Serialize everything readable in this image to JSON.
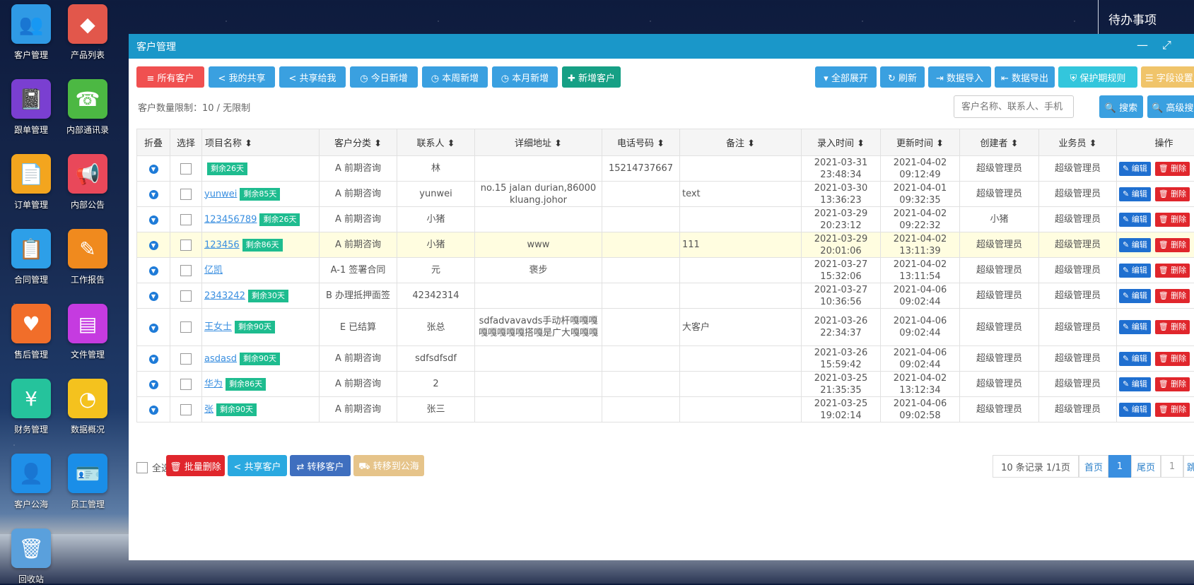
{
  "desktop": {
    "icons": [
      {
        "label": "客户管理",
        "color": "#2f9ae5",
        "glyph": "👥",
        "icon": "users-icon"
      },
      {
        "label": "产品列表",
        "color": "#e2574b",
        "glyph": "◆",
        "icon": "grid-icon"
      },
      {
        "label": "跟单管理",
        "color": "#7a3fd1",
        "glyph": "📓",
        "icon": "notebook-icon"
      },
      {
        "label": "内部通讯录",
        "color": "#4cb843",
        "glyph": "☎",
        "icon": "phone-book-icon"
      },
      {
        "label": "订单管理",
        "color": "#f3a51e",
        "glyph": "📄",
        "icon": "document-icon"
      },
      {
        "label": "内部公告",
        "color": "#e9485a",
        "glyph": "📢",
        "icon": "megaphone-icon"
      },
      {
        "label": "合同管理",
        "color": "#2d9fe8",
        "glyph": "📋",
        "icon": "contract-icon"
      },
      {
        "label": "工作报告",
        "color": "#f08a1e",
        "glyph": "✎",
        "icon": "report-icon"
      },
      {
        "label": "售后管理",
        "color": "#f16e2a",
        "glyph": "♥",
        "icon": "handshake-icon"
      },
      {
        "label": "文件管理",
        "color": "#c53be0",
        "glyph": "▤",
        "icon": "file-icon"
      },
      {
        "label": "财务管理",
        "color": "#25c39c",
        "glyph": "¥",
        "icon": "finance-icon"
      },
      {
        "label": "数据概况",
        "color": "#f4c21e",
        "glyph": "◔",
        "icon": "pie-chart-icon"
      },
      {
        "label": "客户公海",
        "color": "#1f8fe8",
        "glyph": "👤",
        "icon": "customer-pool-icon"
      },
      {
        "label": "员工管理",
        "color": "#1a8ee8",
        "glyph": "🪪",
        "icon": "badge-icon"
      },
      {
        "label": "回收站",
        "color": "#5aa0dc",
        "glyph": "🗑",
        "icon": "trash-icon"
      }
    ],
    "todo": "待办事项"
  },
  "window": {
    "title": "客户管理",
    "minimize": "—",
    "maximize": "⤢"
  },
  "toolbar": {
    "left": [
      {
        "label": "≡ 所有客户",
        "style": "red"
      },
      {
        "label": "< 我的共享",
        "style": "blue"
      },
      {
        "label": "< 共享给我",
        "style": "blue"
      },
      {
        "label": "◷ 今日新增",
        "style": "blue"
      },
      {
        "label": "◷ 本周新增",
        "style": "blue"
      },
      {
        "label": "◷ 本月新增",
        "style": "blue"
      },
      {
        "label": "✚ 新增客户",
        "style": "teal"
      }
    ],
    "right": [
      {
        "label": "▾ 全部展开",
        "style": "blue"
      },
      {
        "label": "↻ 刷新",
        "style": "blue"
      },
      {
        "label": "⇥ 数据导入",
        "style": "blue"
      },
      {
        "label": "⇤ 数据导出",
        "style": "blue"
      },
      {
        "label": "⛨ 保护期规则",
        "style": "cyan"
      },
      {
        "label": "☰ 字段设置",
        "style": "yellow"
      }
    ]
  },
  "info": "客户数量限制：10 / 无限制",
  "search": {
    "placeholder": "客户名称、联系人、手机",
    "button": "🔍 搜索",
    "advanced": "🔍 高级搜索"
  },
  "table": {
    "headers": [
      "折叠",
      "选择",
      "项目名称 ⬍",
      "客户分类 ⬍",
      "联系人 ⬍",
      "详细地址 ⬍",
      "电话号码 ⬍",
      "备注 ⬍",
      "录入时间 ⬍",
      "更新时间 ⬍",
      "创建者 ⬍",
      "业务员 ⬍",
      "操作"
    ],
    "rows": [
      {
        "name": "",
        "tag": "剩余26天",
        "category": "A 前期咨询",
        "contact": "林",
        "address": "",
        "phone": "15214737667",
        "note": "",
        "created": "2021-03-31 23:48:34",
        "updated": "2021-04-02 09:12:49",
        "creator": "超级管理员",
        "sales": "超级管理员"
      },
      {
        "name": "yunwei",
        "tag": "剩余85天",
        "category": "A 前期咨询",
        "contact": "yunwei",
        "address": "no.15 jalan durian,86000 kluang.johor",
        "phone": "",
        "note": "text",
        "created": "2021-03-30 13:36:23",
        "updated": "2021-04-01 09:32:35",
        "creator": "超级管理员",
        "sales": "超级管理员"
      },
      {
        "name": "123456789",
        "tag": "剩余26天",
        "category": "A 前期咨询",
        "contact": "小猪",
        "address": "",
        "phone": "",
        "note": "",
        "created": "2021-03-29 20:23:12",
        "updated": "2021-04-02 09:22:32",
        "creator": "小猪",
        "sales": "超级管理员"
      },
      {
        "name": "123456",
        "tag": "剩余86天",
        "category": "A 前期咨询",
        "contact": "小猪",
        "address": "www",
        "phone": "",
        "note": "111",
        "created": "2021-03-29 20:01:06",
        "updated": "2021-04-02 13:11:39",
        "creator": "超级管理员",
        "sales": "超级管理员"
      },
      {
        "name": "亿凯",
        "tag": "",
        "category": "A-1 签署合同",
        "contact": "元",
        "address": "褒步",
        "phone": "",
        "note": "",
        "created": "2021-03-27 15:32:06",
        "updated": "2021-04-02 13:11:54",
        "creator": "超级管理员",
        "sales": "超级管理员"
      },
      {
        "name": "2343242",
        "tag": "剩余30天",
        "category": "B 办理抵押面签",
        "contact": "42342314",
        "address": "",
        "phone": "",
        "note": "",
        "created": "2021-03-27 10:36:56",
        "updated": "2021-04-06 09:02:44",
        "creator": "超级管理员",
        "sales": "超级管理员"
      },
      {
        "name": "王女士",
        "tag": "剩余90天",
        "category": "E 已结算",
        "contact": "张总",
        "address": "sdfadvavavds手动杆嘎嘎嘎嘎嘎嘎嘎嘎搭嘎是广大嘎嘎嘎",
        "phone": "",
        "note": "大客户",
        "created": "2021-03-26 22:34:37",
        "updated": "2021-04-06 09:02:44",
        "creator": "超级管理员",
        "sales": "超级管理员"
      },
      {
        "name": "asdasd",
        "tag": "剩余90天",
        "category": "A 前期咨询",
        "contact": "sdfsdfsdf",
        "address": "",
        "phone": "",
        "note": "",
        "created": "2021-03-26 15:59:42",
        "updated": "2021-04-06 09:02:44",
        "creator": "超级管理员",
        "sales": "超级管理员"
      },
      {
        "name": "华为",
        "tag": "剩余86天",
        "category": "A 前期咨询",
        "contact": "2",
        "address": "",
        "phone": "",
        "note": "",
        "created": "2021-03-25 21:35:35",
        "updated": "2021-04-02 13:12:34",
        "creator": "超级管理员",
        "sales": "超级管理员"
      },
      {
        "name": "张",
        "tag": "剩余90天",
        "category": "A 前期咨询",
        "contact": "张三",
        "address": "",
        "phone": "",
        "note": "",
        "created": "2021-03-25 19:02:14",
        "updated": "2021-04-06 09:02:58",
        "creator": "超级管理员",
        "sales": "超级管理员"
      }
    ],
    "edit": "✎ 编辑",
    "delete": "🗑 删除"
  },
  "footer": {
    "select_all": "全选",
    "buttons": [
      {
        "label": "🗑 批量删除",
        "style": "#e0262c"
      },
      {
        "label": "< 共享客户",
        "style": "#2aa9e0"
      },
      {
        "label": "⇄ 转移客户",
        "style": "#3f6fbf"
      },
      {
        "label": "⛟ 转移到公海",
        "style": "#e6c48a"
      }
    ]
  },
  "pager": {
    "summary": "10 条记录 1/1页",
    "first": "首页",
    "current": "1",
    "last": "尾页",
    "jump_value": "1",
    "jump": "跳转"
  }
}
